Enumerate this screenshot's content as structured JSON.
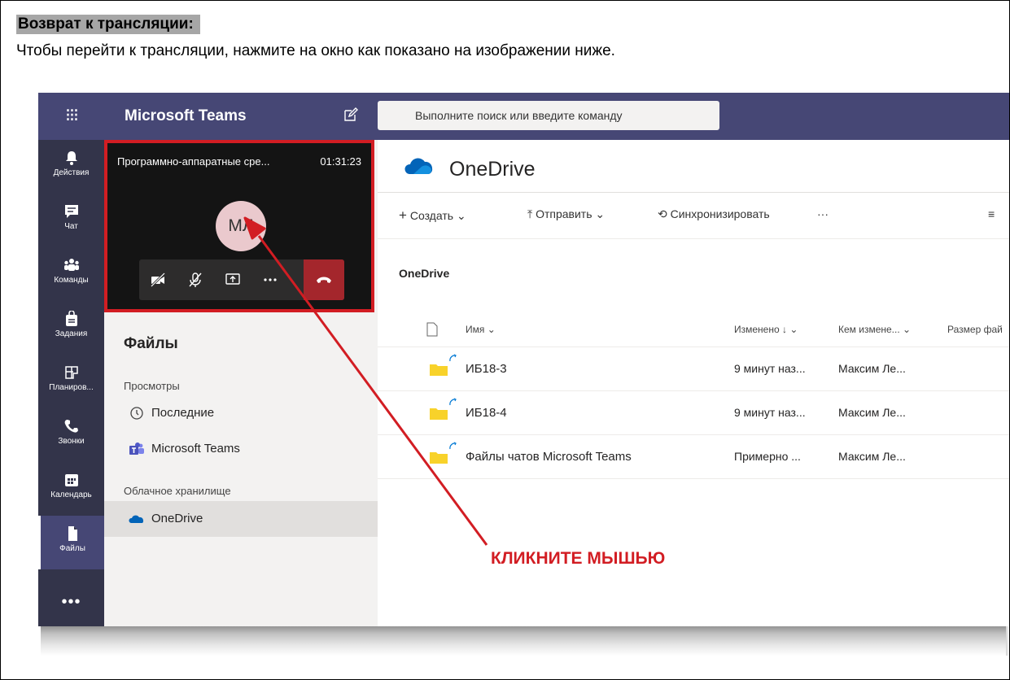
{
  "document": {
    "heading": "Возврат к трансляции:",
    "instruction": "Чтобы перейти к трансляции, нажмите на окно как показано на изображении ниже.",
    "annotation": "КЛИКНИТЕ МЫШЬЮ"
  },
  "teams": {
    "app_title": "Microsoft Teams",
    "search_placeholder": "Выполните поиск или введите команду",
    "rail": [
      {
        "label": "Действия",
        "icon": "bell-icon"
      },
      {
        "label": "Чат",
        "icon": "chat-icon"
      },
      {
        "label": "Команды",
        "icon": "teams-icon"
      },
      {
        "label": "Задания",
        "icon": "assignments-icon"
      },
      {
        "label": "Планиров...",
        "icon": "planner-icon"
      },
      {
        "label": "Звонки",
        "icon": "phone-icon"
      },
      {
        "label": "Календарь",
        "icon": "calendar-icon"
      },
      {
        "label": "Файлы",
        "icon": "file-icon",
        "active": true
      }
    ],
    "rail_more": "•••",
    "meeting": {
      "title": "Программно-аппаратные сре...",
      "timer": "01:31:23",
      "avatar_initials": "МЛ"
    },
    "files_pane": {
      "title": "Файлы",
      "section_views": "Просмотры",
      "recent": "Последние",
      "microsoft_teams": "Microsoft Teams",
      "section_cloud": "Облачное хранилище",
      "onedrive": "OneDrive"
    },
    "content": {
      "title": "OneDrive",
      "toolbar": {
        "create": "Создать",
        "upload": "Отправить",
        "sync": "Синхронизировать",
        "more": "···",
        "view": "≡"
      },
      "breadcrumb": "OneDrive",
      "columns": {
        "name": "Имя",
        "modified": "Изменено ↓",
        "modified_by": "Кем измене...",
        "size": "Размер фай"
      },
      "rows": [
        {
          "name": "ИБ18-3",
          "modified": "9 минут наз...",
          "by": "Максим Ле..."
        },
        {
          "name": "ИБ18-4",
          "modified": "9 минут наз...",
          "by": "Максим Ле..."
        },
        {
          "name": "Файлы чатов Microsoft Teams",
          "modified": "Примерно ...",
          "by": "Максим Ле..."
        }
      ]
    }
  },
  "colors": {
    "teams_header": "#464775",
    "rail": "#33344a",
    "highlight_red": "#d21d23",
    "hangup": "#a4262c",
    "onedrive_blue": "#0364b8",
    "folder": "#f8d22a"
  }
}
